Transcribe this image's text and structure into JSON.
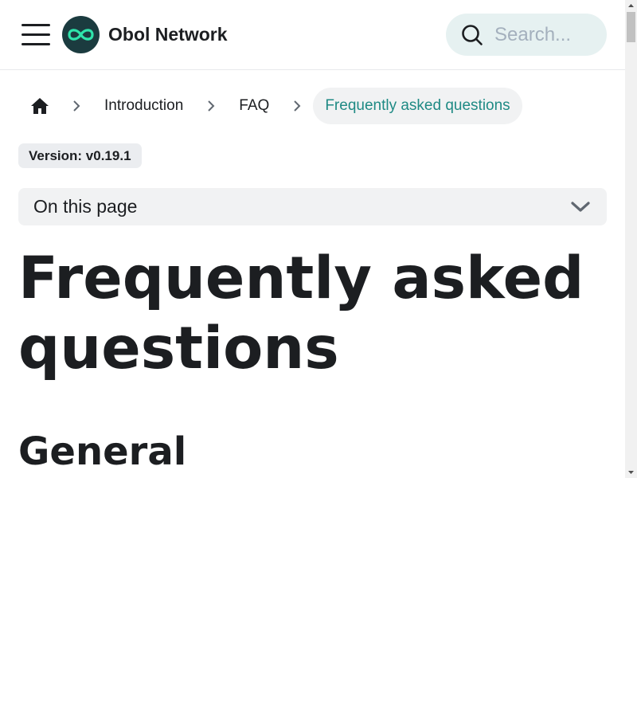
{
  "navbar": {
    "brand": "Obol Network",
    "search_placeholder": "Search..."
  },
  "breadcrumb": {
    "items": [
      "Introduction",
      "FAQ",
      "Frequently asked questions"
    ]
  },
  "version_badge": "Version: v0.19.1",
  "toc_label": "On this page",
  "page_title": "Frequently asked questions",
  "section_heading": "General",
  "icons": {
    "menu": "hamburger-icon",
    "logo": "obol-infinity-logo",
    "search": "search-icon",
    "home": "home-icon",
    "separator": "chevron-right-icon",
    "toc_toggle": "chevron-down-icon"
  },
  "colors": {
    "accent": "#1f8a84",
    "logo_bg": "#1b3b3f",
    "logo_mark": "#2fe4ab",
    "search_bg": "#e6f1f1"
  }
}
